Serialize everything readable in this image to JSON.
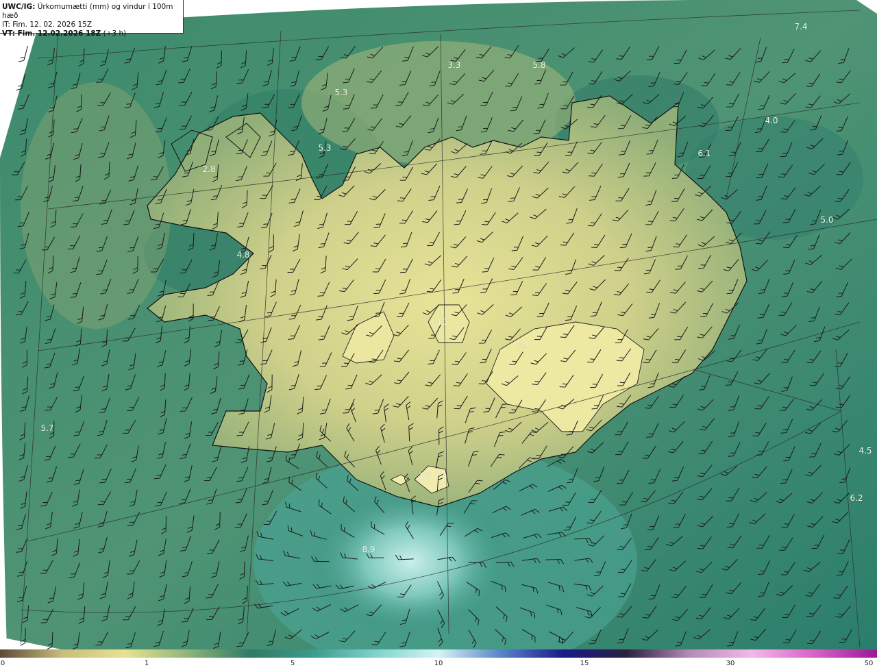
{
  "header": {
    "product": "UWC/IG:",
    "description": "Úrkomumætti (mm) og vindur í 100m hæð",
    "init_time": "IT: Fim. 12. 02. 2026 15Z",
    "valid_label": "VT: Fim. 12.02.2026 18Z",
    "valid_suffix": "(+3 h)"
  },
  "value_labels": [
    {
      "text": "7.4"
    },
    {
      "text": "3.3"
    },
    {
      "text": "5.8"
    },
    {
      "text": "5.3"
    },
    {
      "text": "4.0"
    },
    {
      "text": "5.3"
    },
    {
      "text": "6.1"
    },
    {
      "text": "2.8"
    },
    {
      "text": "5.0"
    },
    {
      "text": "4.8"
    },
    {
      "text": "0.3"
    },
    {
      "text": "1.1"
    },
    {
      "text": "5.7"
    },
    {
      "text": "4.5"
    },
    {
      "text": "1.7"
    },
    {
      "text": "6.2"
    },
    {
      "text": "8.9"
    }
  ],
  "colorbar": {
    "ticks": [
      "0",
      "1",
      "5",
      "10",
      "15",
      "30",
      "50"
    ],
    "colors": [
      "#5c4a3a",
      "#c9bd7a",
      "#e8e292",
      "#8fb47a",
      "#2f7a66",
      "#3d9b8c",
      "#7fd3cc",
      "#d4f4f4",
      "#5a83c8",
      "#1b1a8a",
      "#2a2040",
      "#b48ab8",
      "#f3b8e8",
      "#d861c8",
      "#9a1a98"
    ]
  },
  "map": {
    "colors": {
      "sea_dark": "#1f6b5b",
      "sea_mid": "#3a8a72",
      "land_light": "#e6e195",
      "land_mid": "#b9c07e",
      "high_precip": "#9fd8ce",
      "coast": "#111111"
    }
  }
}
